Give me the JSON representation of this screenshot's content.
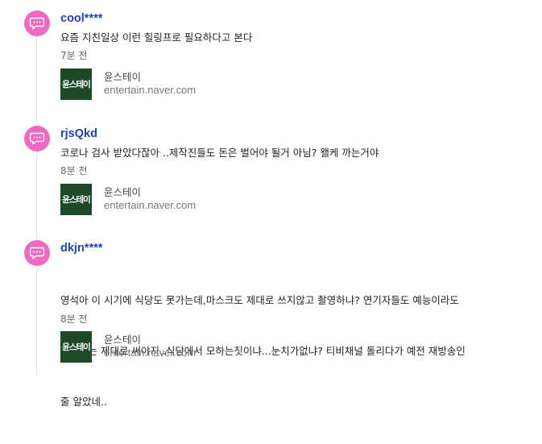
{
  "comments": [
    {
      "username": "cool****",
      "text": "요즘 지친일상 이런 힐링프로 필요하다고 본다",
      "time": "7분 전",
      "source": {
        "thumb_text": "윤스테이",
        "name": "윤스테이",
        "domain": "entertain.naver.com"
      }
    },
    {
      "username": "rjsQkd",
      "text": "코로나 검사 받았다잖아 ..제작진들도 돈은 벌어야 될거 아님? 왤케 까는거야",
      "time": "8분 전",
      "source": {
        "thumb_text": "윤스테이",
        "name": "윤스테이",
        "domain": "entertain.naver.com"
      }
    },
    {
      "username": "dkjn****",
      "text_lines": [
        "영석아 이 시기에 식당도 못가는데,마스크도 제대로 쓰지않고 촬영하냐? 연기자들도 예능이라도",
        "마스크는 제대로 써야지..식당에서 모하는짓이냐...눈치가없냐? 티비채널 돌리다가 예전 재방송인",
        "줄 알았네.."
      ],
      "time": "8분 전",
      "source": {
        "thumb_text": "윤스테이",
        "name": "윤스테이",
        "domain": "entertain.naver.com"
      }
    }
  ],
  "colors": {
    "avatar": "#ec6ac2",
    "username": "#2244aa",
    "thumb_bg": "#1f4a2a"
  },
  "icons": {
    "avatar": "chat-bubble-icon"
  }
}
